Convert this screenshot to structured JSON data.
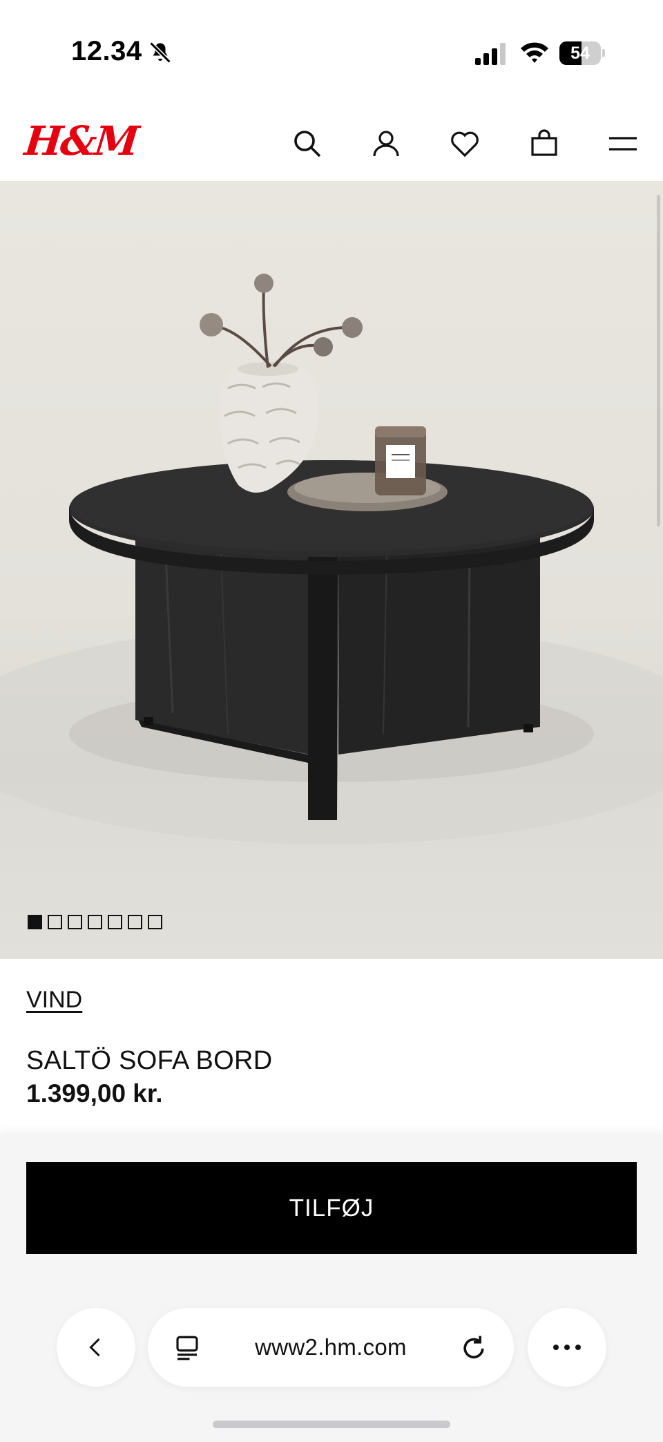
{
  "status_bar": {
    "time": "12.34",
    "battery_level": "54",
    "battery_fraction": 0.54,
    "icons": [
      "bell-slash-icon",
      "cellular-signal-icon",
      "wifi-icon",
      "battery-icon"
    ]
  },
  "header": {
    "logo_text": "H&M",
    "logo_color": "#e50010",
    "icons": [
      "search-icon",
      "account-icon",
      "heart-icon",
      "shopping-bag-icon",
      "menu-icon"
    ]
  },
  "gallery": {
    "image_count": 7,
    "active_index": 0,
    "image_subject": "black round wooden coffee table with vase, candle and tray"
  },
  "product": {
    "brand": "VIND",
    "name": "SALTÖ SOFA BORD",
    "price": "1.399,00 kr."
  },
  "add_bar": {
    "add_label": "TILFØJ"
  },
  "browser": {
    "url": "www2.hm.com",
    "icons": [
      "back-chevron-icon",
      "reader-icon",
      "reload-icon",
      "more-icon"
    ]
  }
}
